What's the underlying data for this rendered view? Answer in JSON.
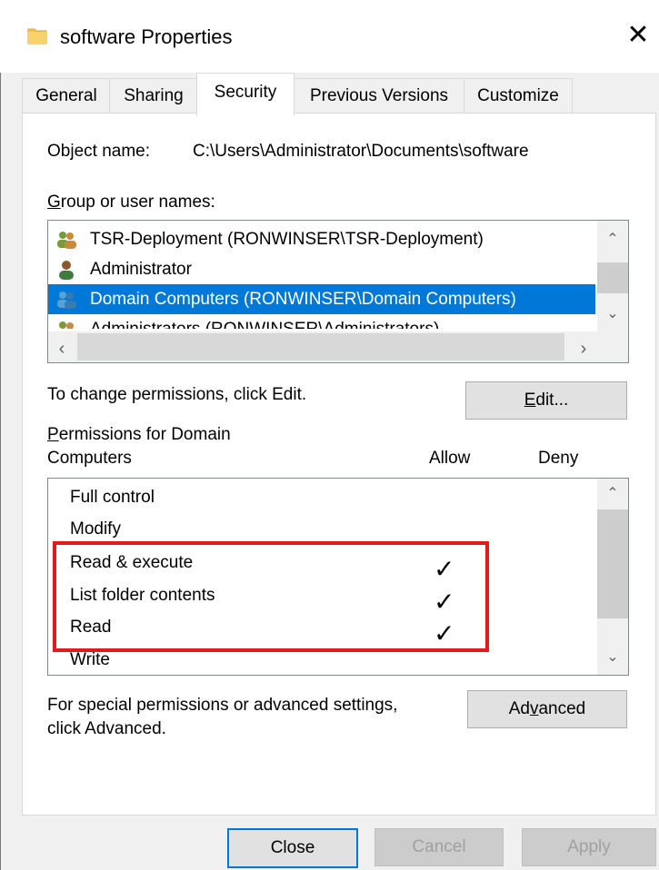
{
  "window": {
    "title": "software Properties",
    "close_glyph": "✕",
    "icon": "folder-icon"
  },
  "tabs": [
    {
      "label": "General",
      "active": false
    },
    {
      "label": "Sharing",
      "active": false
    },
    {
      "label": "Security",
      "active": true
    },
    {
      "label": "Previous Versions",
      "active": false
    },
    {
      "label": "Customize",
      "active": false
    }
  ],
  "security": {
    "object_name_label": "Object name:",
    "object_name_value": "C:\\Users\\Administrator\\Documents\\software",
    "group_label": "Group or user names:",
    "groups": [
      {
        "name": "TSR-Deployment (RONWINSER\\TSR-Deployment)",
        "icon": "group-users-icon",
        "selected": false
      },
      {
        "name": "Administrator",
        "icon": "user-icon",
        "selected": false
      },
      {
        "name": "Domain Computers (RONWINSER\\Domain Computers)",
        "icon": "group-users-icon",
        "selected": true
      },
      {
        "name": "Administrators (RONWINSER\\Administrators)",
        "icon": "group-users-icon",
        "selected": false
      }
    ],
    "change_hint": "To change permissions, click Edit.",
    "edit_button": {
      "prefix": "",
      "accel": "E",
      "suffix": "dit..."
    },
    "permissions_label_line1": "Permissions for Domain",
    "permissions_label_line2": "Computers",
    "allow_header": "Allow",
    "deny_header": "Deny",
    "permissions": [
      {
        "name": "Full control",
        "allow": false,
        "deny": false
      },
      {
        "name": "Modify",
        "allow": false,
        "deny": false
      },
      {
        "name": "Read & execute",
        "allow": true,
        "deny": false
      },
      {
        "name": "List folder contents",
        "allow": true,
        "deny": false
      },
      {
        "name": "Read",
        "allow": true,
        "deny": false
      },
      {
        "name": "Write",
        "allow": false,
        "deny": false
      }
    ],
    "check_glyph": "✓",
    "special_hint_line1": "For special permissions or advanced settings,",
    "special_hint_line2": "click Advanced.",
    "advanced_button": {
      "prefix": "Ad",
      "accel": "v",
      "suffix": "anced"
    }
  },
  "footer": {
    "close_label": "Close",
    "cancel_label": "Cancel",
    "apply_label": "Apply"
  },
  "colors": {
    "selection": "#0078d7",
    "highlight_box": "#e3191c",
    "default_button_border": "#0078d7"
  }
}
